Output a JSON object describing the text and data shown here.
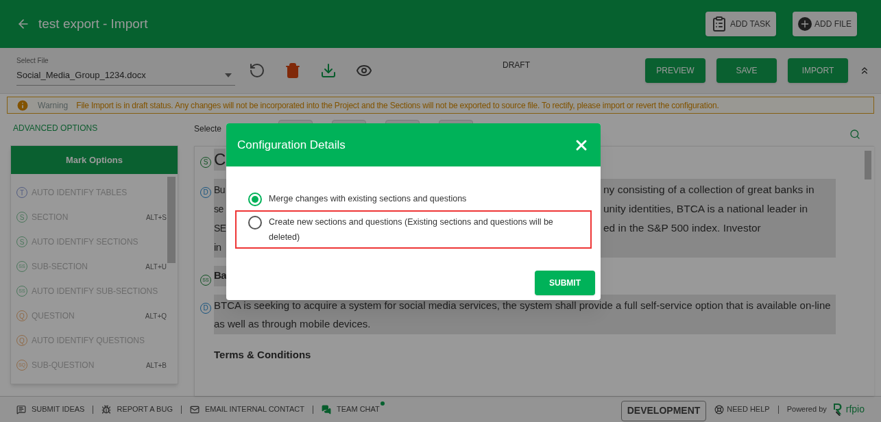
{
  "header": {
    "title": "test export - Import",
    "buttons": [
      {
        "label": "ADD TASK"
      },
      {
        "label": "ADD FILE"
      }
    ]
  },
  "toolbar": {
    "file_select": {
      "label": "Select File",
      "value": "Social_Media_Group_1234.docx"
    },
    "status": "DRAFT",
    "buttons": [
      "PREVIEW",
      "SAVE",
      "IMPORT"
    ]
  },
  "warning": {
    "label": "Warning",
    "message": "File Import is in draft status. Any changes will not be incorporated into the Project and the Sections will not be exported to source file. To rectify, please import or revert the configuration."
  },
  "advanced_options": "ADVANCED OPTIONS",
  "selected_label": "Selecte",
  "mark_options": {
    "title": "Mark Options",
    "items": [
      {
        "kind": "table",
        "badge": "T",
        "label": "AUTO IDENTIFY TABLES"
      },
      {
        "kind": "section",
        "badge": "S",
        "label": "SECTION",
        "shortcut": "ALT+S"
      },
      {
        "kind": "section",
        "badge": "S",
        "label": "AUTO IDENTIFY SECTIONS"
      },
      {
        "kind": "section",
        "badge": "SS",
        "label": "SUB-SECTION",
        "shortcut": "ALT+U"
      },
      {
        "kind": "section",
        "badge": "SS",
        "label": "AUTO IDENTIFY SUB-SECTIONS"
      },
      {
        "kind": "question",
        "badge": "Q",
        "label": "QUESTION",
        "shortcut": "ALT+Q"
      },
      {
        "kind": "question",
        "badge": "Q",
        "label": "AUTO IDENTIFY QUESTIONS"
      },
      {
        "kind": "question",
        "badge": "SQ",
        "label": "SUB-QUESTION",
        "shortcut": "ALT+B"
      }
    ]
  },
  "document": [
    {
      "kind": "heading",
      "badge": "S",
      "lines": [
        {
          "left": "C"
        }
      ]
    },
    {
      "kind": "paragraph",
      "badge": "D",
      "lines": [
        {
          "left": "Bu",
          "right": "ny consisting of a collection of great banks in"
        },
        {
          "left": "se",
          "right": "unity identities, BTCA is a national leader in"
        },
        {
          "left": "SE",
          "right": "ed in the S&P 500 index. Investor"
        },
        {
          "left": "in"
        }
      ]
    },
    {
      "kind": "subheading",
      "badge": "SS",
      "lines": [
        {
          "left": "Ba"
        }
      ]
    },
    {
      "kind": "paragraph",
      "badge": "D",
      "lines": [
        {
          "left": "BTCA is seeking to acquire a system for social media services, the system shall provide a full self-service option that is available on-line as well as through mobile devices."
        }
      ]
    },
    {
      "kind": "title",
      "lines": [
        {
          "left": "Terms & Conditions"
        }
      ]
    }
  ],
  "modal": {
    "title": "Configuration Details",
    "options": [
      {
        "label": "Merge changes with existing sections and questions",
        "selected": true,
        "highlighted": false
      },
      {
        "label": "Create new sections and questions (Existing sections and questions will be deleted)",
        "selected": false,
        "highlighted": true
      }
    ],
    "submit": "SUBMIT"
  },
  "footer": {
    "links": [
      {
        "label": "SUBMIT IDEAS",
        "online": false
      },
      {
        "label": "REPORT A BUG",
        "online": false
      },
      {
        "label": "EMAIL INTERNAL CONTACT",
        "online": false
      },
      {
        "label": "TEAM CHAT",
        "online": true
      }
    ],
    "environment": "DEVELOPMENT",
    "help": "NEED HELP",
    "powered_by": "Powered by",
    "logo_text": "rfpio"
  }
}
